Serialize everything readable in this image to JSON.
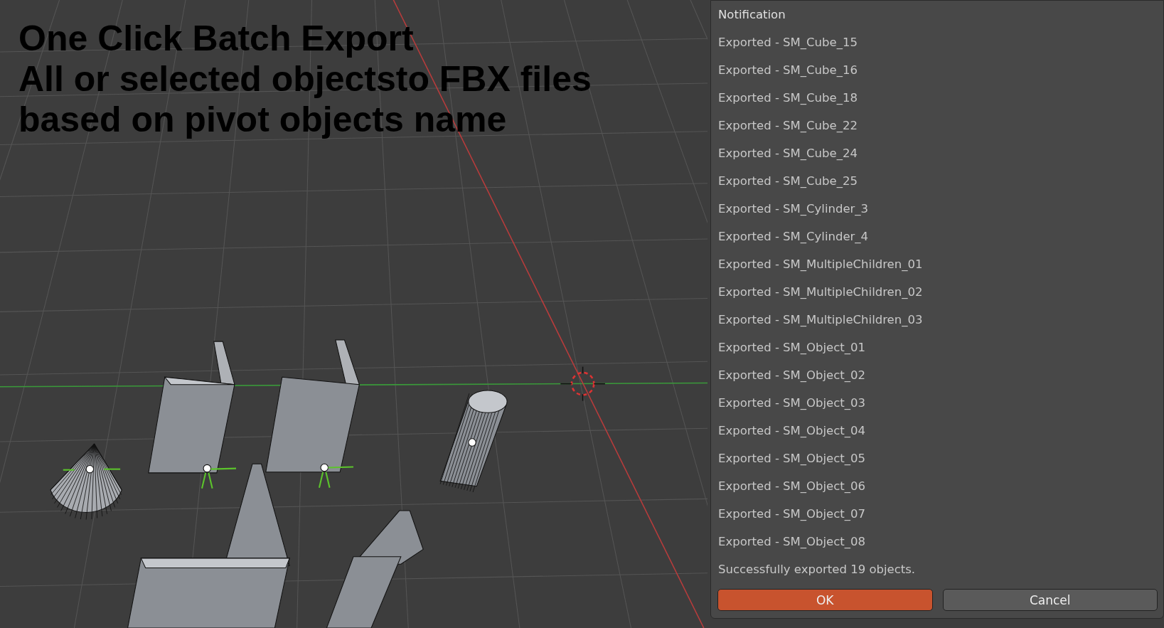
{
  "viewport": {
    "overlay_lines": [
      "One Click Batch Export",
      "All or selected objectsto FBX files",
      "based on pivot objects name"
    ]
  },
  "dialog": {
    "title": "Notification",
    "messages": [
      "Exported - SM_Cube_15",
      "Exported - SM_Cube_16",
      "Exported - SM_Cube_18",
      "Exported - SM_Cube_22",
      "Exported - SM_Cube_24",
      "Exported - SM_Cube_25",
      "Exported - SM_Cylinder_3",
      "Exported - SM_Cylinder_4",
      "Exported - SM_MultipleChildren_01",
      "Exported - SM_MultipleChildren_02",
      "Exported - SM_MultipleChildren_03",
      "Exported - SM_Object_01",
      "Exported - SM_Object_02",
      "Exported - SM_Object_03",
      "Exported - SM_Object_04",
      "Exported - SM_Object_05",
      "Exported - SM_Object_06",
      "Exported - SM_Object_07",
      "Exported - SM_Object_08"
    ],
    "summary": "Successfully exported 19 objects.",
    "buttons": [
      {
        "label": "OK",
        "kind": "primary"
      },
      {
        "label": "Cancel",
        "kind": "secondary"
      }
    ]
  }
}
